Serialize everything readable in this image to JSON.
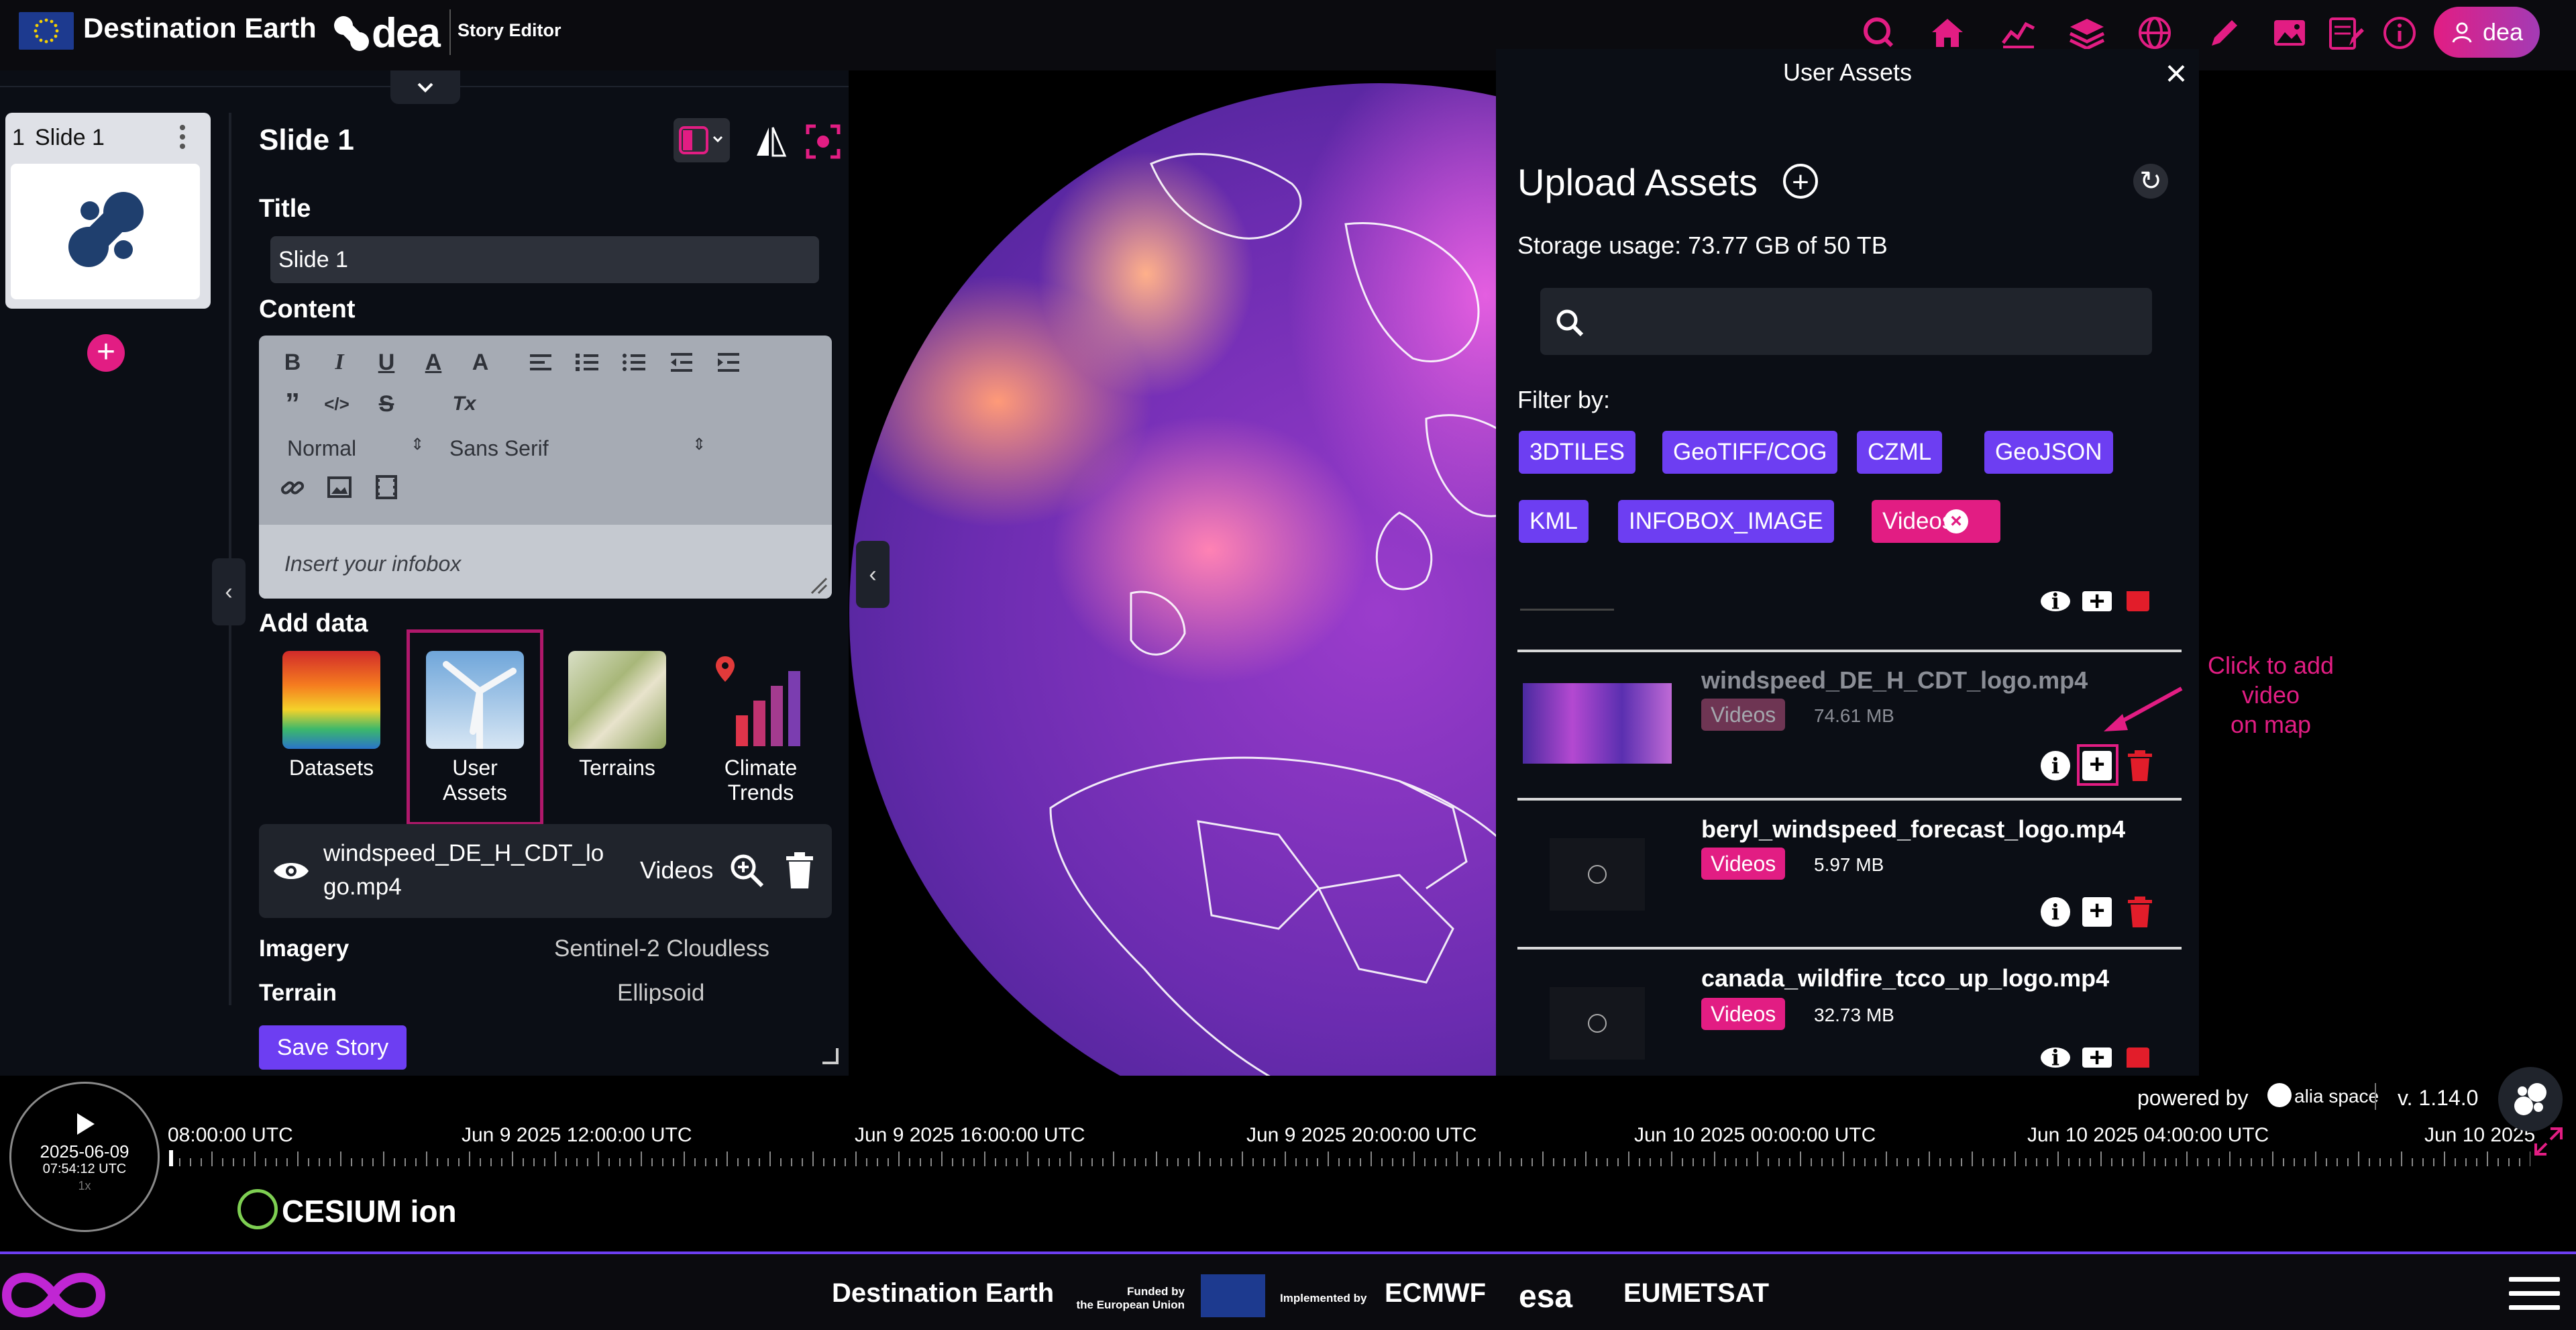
{
  "header": {
    "title": "Destination Earth",
    "logo_text": "dea",
    "subtitle": "Story Editor",
    "user_label": "dea",
    "icons": [
      "search-icon",
      "home-icon",
      "chart-icon",
      "layers-icon",
      "globe-icon",
      "pencil-icon",
      "image-icon",
      "story-icon",
      "info-icon"
    ],
    "accent": "#e21d83"
  },
  "slides": {
    "items": [
      {
        "number": "1",
        "label": "Slide 1"
      }
    ],
    "add_button": "+"
  },
  "editor": {
    "slide_title": "Slide 1",
    "title_label": "Title",
    "title_value": "Slide 1",
    "content_label": "Content",
    "toolbar": {
      "bold": "B",
      "italic": "I",
      "underline": "U",
      "color": "A",
      "highlight": "A",
      "quote": "”",
      "code": "</>",
      "strike": "S",
      "clear": "Tx",
      "size_select": "Normal",
      "font_select": "Sans Serif"
    },
    "infobox_placeholder": "Insert your infobox",
    "add_data_label": "Add data",
    "add_data": [
      {
        "label1": "Datasets",
        "label2": ""
      },
      {
        "label1": "User",
        "label2": "Assets"
      },
      {
        "label1": "Terrains",
        "label2": ""
      },
      {
        "label1": "Climate",
        "label2": "Trends"
      }
    ],
    "layer": {
      "name1": "windspeed_DE_H_CDT_lo",
      "name2": "go.mp4",
      "type": "Videos"
    },
    "imagery_label": "Imagery",
    "imagery_value": "Sentinel-2 Cloudless",
    "terrain_label": "Terrain",
    "terrain_value": "Ellipsoid",
    "save_label": "Save Story"
  },
  "assets": {
    "panel_title": "User Assets",
    "upload_title": "Upload Assets",
    "storage": "Storage usage: 73.77 GB of 50 TB",
    "search_placeholder": "",
    "filter_label": "Filter by:",
    "filters": [
      "3DTILES",
      "GeoTIFF/COG",
      "CZML",
      "GeoJSON",
      "KML",
      "INFOBOX_IMAGE",
      "Videos"
    ],
    "active_filter": "Videos",
    "items": [
      {
        "name": "windspeed_DE_H_CDT_logo.mp4",
        "type": "Videos",
        "size": "74.61 MB"
      },
      {
        "name": "beryl_windspeed_forecast_logo.mp4",
        "type": "Videos",
        "size": "5.97 MB"
      },
      {
        "name": "canada_wildfire_tcco_up_logo.mp4",
        "type": "Videos",
        "size": "32.73 MB"
      }
    ],
    "annotation_line1": "Click to add video",
    "annotation_line2": "on map"
  },
  "timeline": {
    "date": "2025-06-09",
    "time": "07:54:12 UTC",
    "speed": "1x",
    "labels": [
      "08:00:00 UTC",
      "Jun 9 2025 12:00:00 UTC",
      "Jun 9 2025 16:00:00 UTC",
      "Jun 9 2025 20:00:00 UTC",
      "Jun 10 2025 00:00:00 UTC",
      "Jun 10 2025 04:00:00 UTC",
      "Jun 10 2025"
    ],
    "powered_by": "powered by",
    "powered_brand": "alia space",
    "version": "v. 1.14.0",
    "cesium": "CESIUM ion"
  },
  "footer": {
    "title": "Destination Earth",
    "funded_line1": "Funded by",
    "funded_line2": "the European Union",
    "implemented": "Implemented by",
    "org1": "ECMWF",
    "org2": "esa",
    "org3": "EUMETSAT"
  }
}
